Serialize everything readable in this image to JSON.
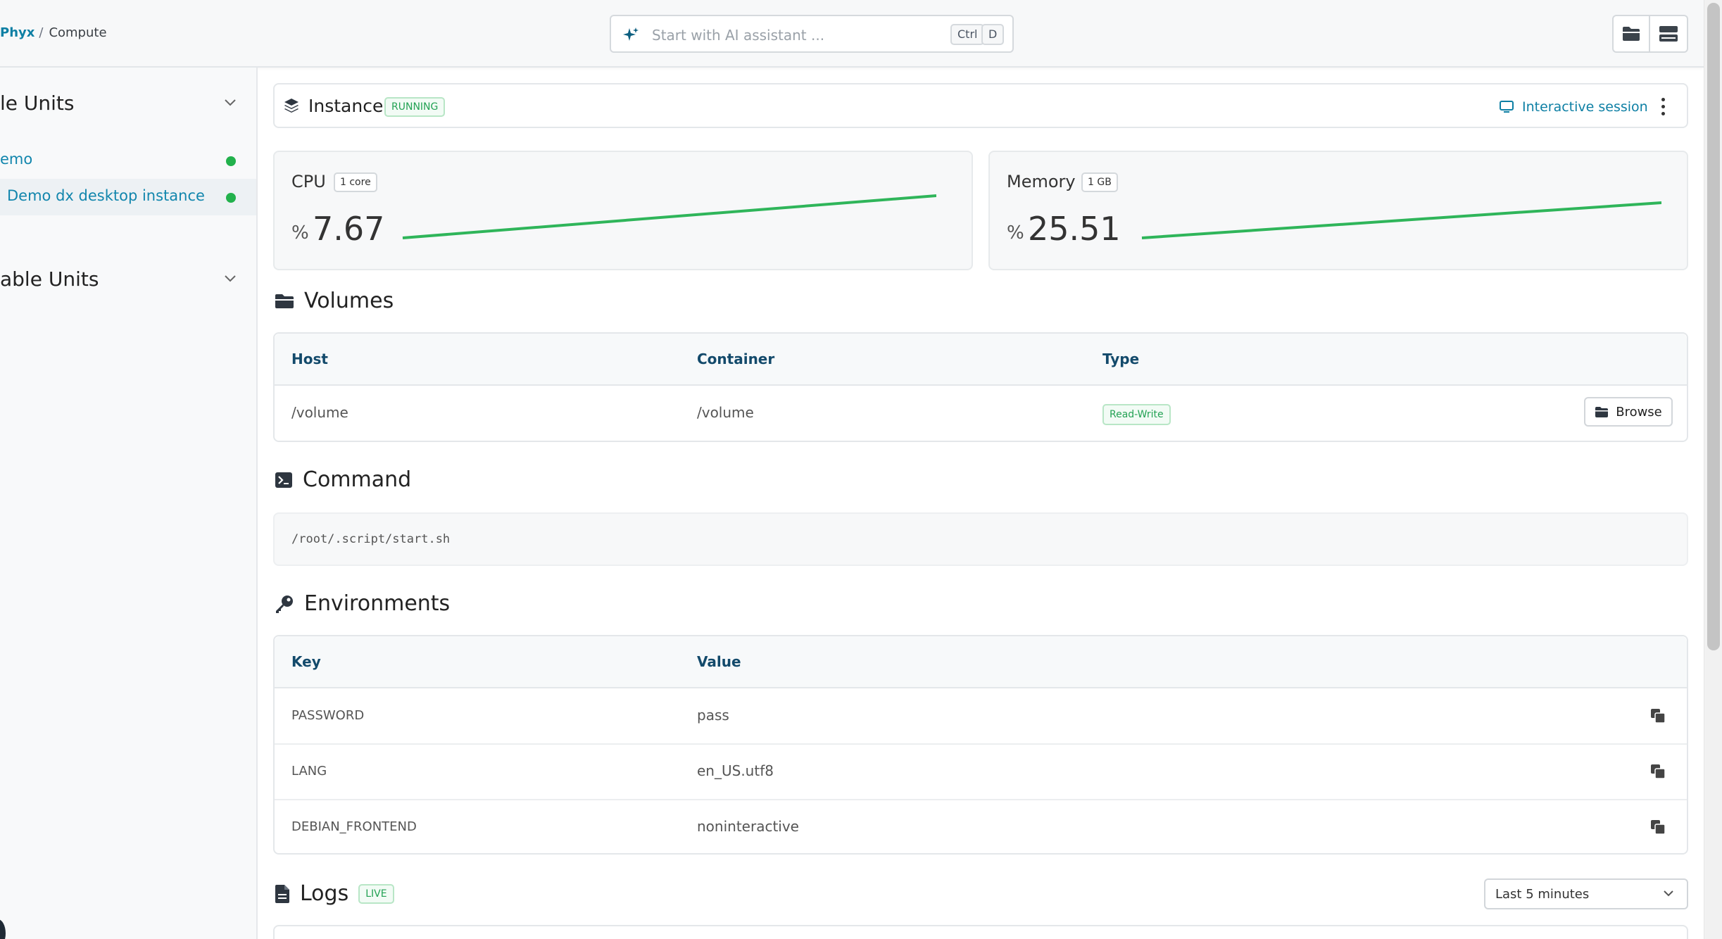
{
  "breadcrumb": {
    "brand": "Phyx",
    "separator": "/",
    "current": "Compute"
  },
  "search": {
    "placeholder": "Start with AI assistant ...",
    "shortcut_ctrl": "Ctrl",
    "shortcut_key": "D"
  },
  "toolbar": {
    "icons": [
      "folder-icon",
      "storage-icon"
    ]
  },
  "sidebar": {
    "groups": [
      {
        "title": "le Units",
        "expanded": true
      },
      {
        "title": "able Units",
        "expanded": true
      }
    ],
    "units": [
      {
        "label": "emo",
        "status": "running"
      },
      {
        "label": "Demo dx desktop instance",
        "status": "running",
        "selected": true
      }
    ]
  },
  "instance": {
    "title": "Instance",
    "status": "RUNNING",
    "session_label": "Interactive session"
  },
  "metrics": {
    "cpu": {
      "name": "CPU",
      "badge": "1 core",
      "unit": "%",
      "value": "7.67"
    },
    "memory": {
      "name": "Memory",
      "badge": "1 GB",
      "unit": "%",
      "value": "25.51"
    }
  },
  "volumes": {
    "title": "Volumes",
    "columns": [
      "Host",
      "Container",
      "Type"
    ],
    "rows": [
      {
        "host": "/volume",
        "container": "/volume",
        "type": "Read-Write",
        "action": "Browse"
      }
    ]
  },
  "command": {
    "title": "Command",
    "value": "/root/.script/start.sh"
  },
  "environments": {
    "title": "Environments",
    "columns": [
      "Key",
      "Value"
    ],
    "rows": [
      {
        "key": "PASSWORD",
        "value": "pass"
      },
      {
        "key": "LANG",
        "value": "en_US.utf8"
      },
      {
        "key": "DEBIAN_FRONTEND",
        "value": "noninteractive"
      }
    ]
  },
  "logs": {
    "title": "Logs",
    "badge": "LIVE",
    "range": "Last 5 minutes"
  },
  "colors": {
    "accent": "#0d7fa4",
    "success": "#22b14c",
    "heading": "#134a6b"
  }
}
